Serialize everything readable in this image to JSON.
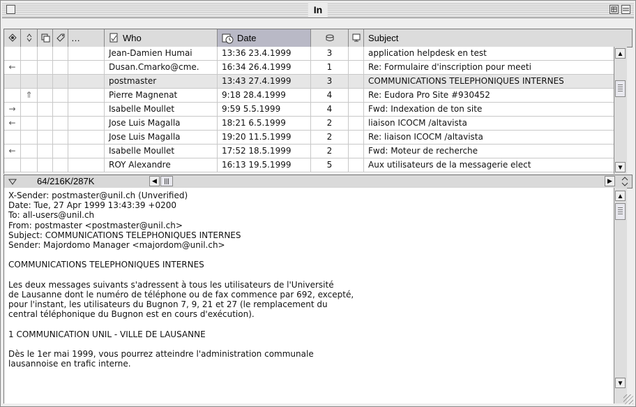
{
  "window": {
    "title": "In"
  },
  "columns": {
    "who": "Who",
    "date": "Date",
    "subject": "Subject"
  },
  "messages": [
    {
      "status": "",
      "priority": "",
      "who": "Jean-Damien Humai",
      "date": "13:36 23.4.1999",
      "size": "3",
      "subject": "application helpdesk en test"
    },
    {
      "status": "←",
      "priority": "",
      "who": "Dusan.Cmarko@cme.",
      "date": "16:34 26.4.1999",
      "size": "1",
      "subject": "Re: Formulaire d'inscription pour meeti"
    },
    {
      "status": "",
      "priority": "",
      "who": "postmaster",
      "date": "13:43 27.4.1999",
      "size": "3",
      "subject": "COMMUNICATIONS TELEPHONIQUES INTERNES",
      "selected": true
    },
    {
      "status": "",
      "priority": "⇑",
      "who": "Pierre Magnenat",
      "date": "9:18 28.4.1999",
      "size": "4",
      "subject": "Re: Eudora Pro Site #930452"
    },
    {
      "status": "→",
      "priority": "",
      "who": "Isabelle Moullet",
      "date": "9:59 5.5.1999",
      "size": "4",
      "subject": "Fwd: Indexation de ton site"
    },
    {
      "status": "←",
      "priority": "",
      "who": "Jose Luis Magalla",
      "date": "18:21 6.5.1999",
      "size": "2",
      "subject": "liaison ICOCM /altavista"
    },
    {
      "status": "",
      "priority": "",
      "who": "Jose Luis Magalla",
      "date": "19:20 11.5.1999",
      "size": "2",
      "subject": "Re: liaison ICOCM /altavista"
    },
    {
      "status": "←",
      "priority": "",
      "who": "Isabelle Moullet",
      "date": "17:52 18.5.1999",
      "size": "2",
      "subject": "Fwd: Moteur de recherche"
    },
    {
      "status": "",
      "priority": "",
      "who": "ROY Alexandre",
      "date": "16:13 19.5.1999",
      "size": "5",
      "subject": "Aux utilisateurs de la messagerie elect"
    }
  ],
  "mailbox_size": "64/216K/287K",
  "preview": {
    "text": "X-Sender: postmaster@unil.ch (Unverified)\nDate: Tue, 27 Apr 1999 13:43:39 +0200\nTo: all-users@unil.ch\nFrom: postmaster <postmaster@unil.ch>\nSubject: COMMUNICATIONS TELEPHONIQUES INTERNES\nSender: Majordomo Manager <majordom@unil.ch>\n\nCOMMUNICATIONS TELEPHONIQUES INTERNES\n\nLes deux messages suivants s'adressent à tous les utilisateurs de l'Université\nde Lausanne dont le numéro de téléphone ou de fax commence par 692, excepté,\npour l'instant, les utilisateurs du Bugnon 7, 9, 21 et 27 (le remplacement du\ncentral téléphonique du Bugnon est en cours d'exécution).\n\n1 COMMUNICATION UNIL - VILLE DE LAUSANNE\n\nDès le 1er mai 1999, vous pourrez atteindre l'administration communale\nlausannoise en trafic interne."
  }
}
